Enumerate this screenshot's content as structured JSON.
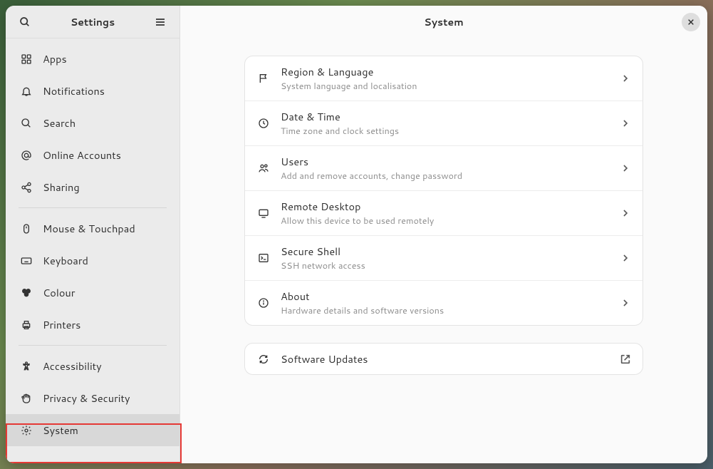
{
  "sidebar": {
    "title": "Settings",
    "groups": [
      [
        {
          "id": "apps",
          "label": "Apps",
          "icon": "apps"
        },
        {
          "id": "notifications",
          "label": "Notifications",
          "icon": "bell"
        },
        {
          "id": "search",
          "label": "Search",
          "icon": "search"
        },
        {
          "id": "online-accounts",
          "label": "Online Accounts",
          "icon": "at"
        },
        {
          "id": "sharing",
          "label": "Sharing",
          "icon": "share"
        }
      ],
      [
        {
          "id": "mouse",
          "label": "Mouse & Touchpad",
          "icon": "mouse"
        },
        {
          "id": "keyboard",
          "label": "Keyboard",
          "icon": "keyboard"
        },
        {
          "id": "colour",
          "label": "Colour",
          "icon": "palette"
        },
        {
          "id": "printers",
          "label": "Printers",
          "icon": "printer"
        }
      ],
      [
        {
          "id": "accessibility",
          "label": "Accessibility",
          "icon": "accessibility"
        },
        {
          "id": "privacy",
          "label": "Privacy & Security",
          "icon": "hand"
        },
        {
          "id": "system",
          "label": "System",
          "icon": "gear",
          "selected": true
        }
      ]
    ]
  },
  "main": {
    "title": "System",
    "panels": [
      {
        "id": "region",
        "title": "Region & Language",
        "subtitle": "System language and localisation",
        "icon": "flag"
      },
      {
        "id": "datetime",
        "title": "Date & Time",
        "subtitle": "Time zone and clock settings",
        "icon": "clock"
      },
      {
        "id": "users",
        "title": "Users",
        "subtitle": "Add and remove accounts, change password",
        "icon": "users"
      },
      {
        "id": "remote",
        "title": "Remote Desktop",
        "subtitle": "Allow this device to be used remotely",
        "icon": "screen"
      },
      {
        "id": "ssh",
        "title": "Secure Shell",
        "subtitle": "SSH network access",
        "icon": "terminal"
      },
      {
        "id": "about",
        "title": "About",
        "subtitle": "Hardware details and software versions",
        "icon": "info"
      }
    ],
    "secondary": [
      {
        "id": "updates",
        "title": "Software Updates",
        "icon": "refresh",
        "action": "external"
      }
    ]
  }
}
